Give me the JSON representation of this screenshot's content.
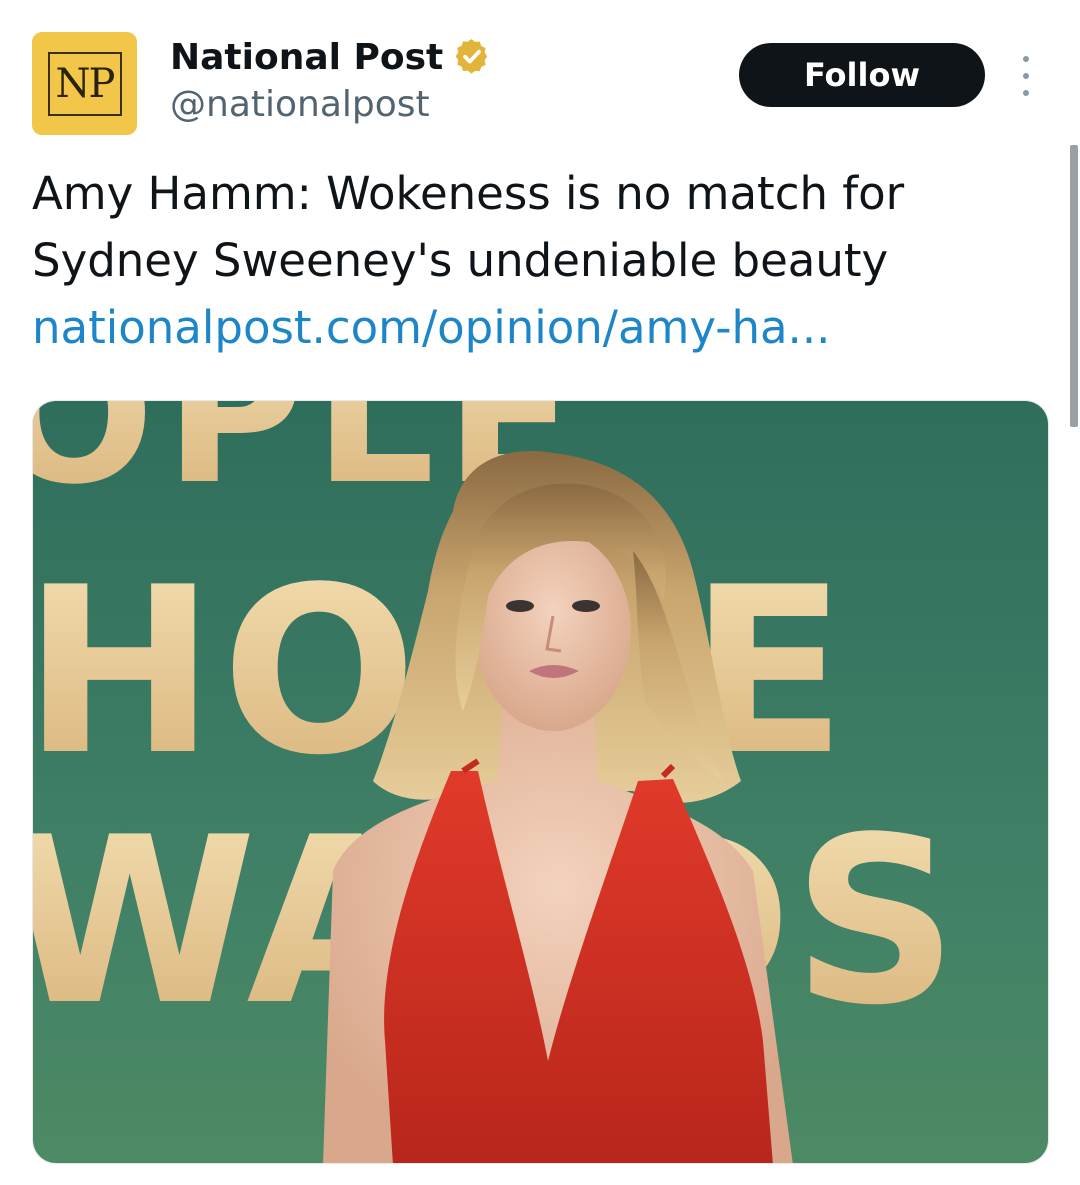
{
  "account": {
    "avatar_text": "NP",
    "display_name": "National Post",
    "handle": "@nationalpost",
    "verified_icon": "verified-gold-badge-icon"
  },
  "actions": {
    "follow_label": "Follow",
    "more_icon": "more-vertical-icon"
  },
  "tweet": {
    "text_line_1": "Amy Hamm: Wokeness is no match for",
    "text_line_2": "Sydney Sweeney's undeniable beauty",
    "link": "nationalpost.com/opinion/amy-ha..."
  },
  "media": {
    "backdrop_letters": {
      "row_1": "OPLE",
      "row_2": "HOICE",
      "row_3": "WARDS"
    }
  },
  "colors": {
    "follow_bg": "#0f1419",
    "link": "#1d86c8",
    "verified_gold": "#e2b53a",
    "avatar_bg": "#f2c648",
    "handle": "#536471"
  }
}
